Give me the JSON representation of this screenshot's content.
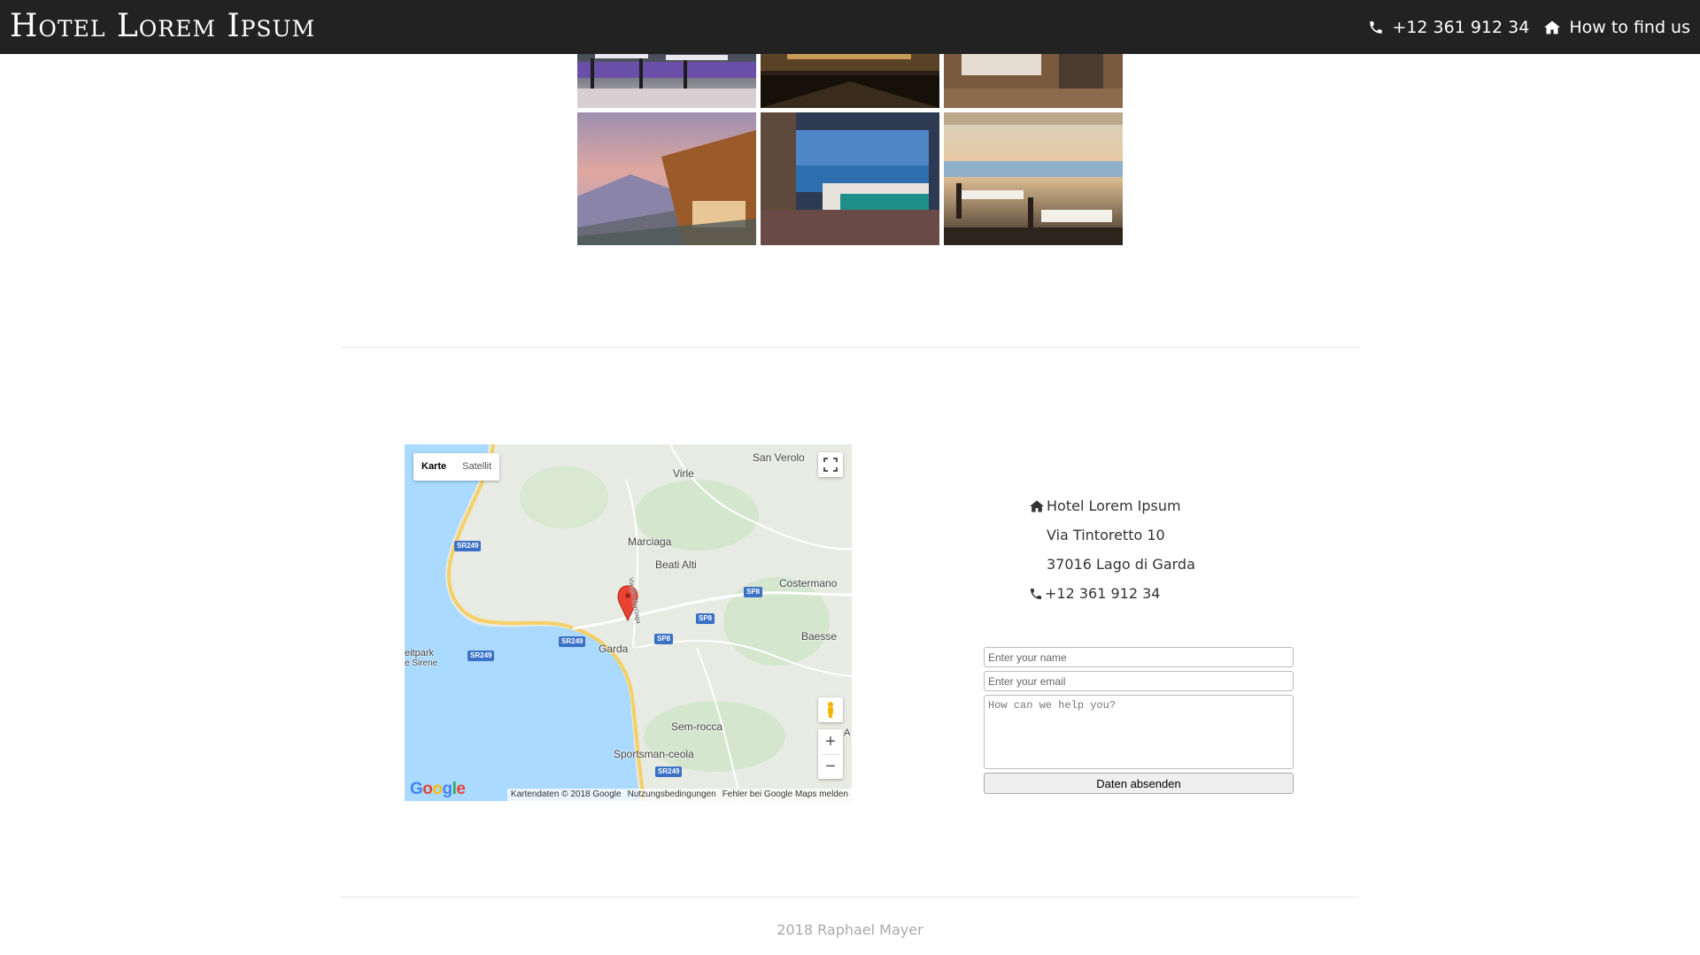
{
  "nav": {
    "brand": "Hotel Lorem Ipsum",
    "phone": "+12 361 912 34",
    "directions": "How to find us",
    "phone_icon": "phone-icon",
    "home_icon": "home-icon"
  },
  "gallery": {
    "images": [
      {
        "label": "restaurant-terrace"
      },
      {
        "label": "lobby-lounge"
      },
      {
        "label": "hotel-room"
      },
      {
        "label": "mountain-balcony"
      },
      {
        "label": "seaview-bedroom"
      },
      {
        "label": "seaside-dining"
      }
    ]
  },
  "map": {
    "map_type": [
      "Karte",
      "Satellit"
    ],
    "places": [
      "San Verolo",
      "Virle",
      "Marciaga",
      "Beati Alti",
      "Costermano",
      "Baesse",
      "Garda",
      "Sem-rocca",
      "Sportsman-ceola",
      "eitpark",
      "e Sirene",
      "A",
      "Via per Marciaga"
    ],
    "roads": [
      "SR249",
      "SR249",
      "SR249",
      "SR249",
      "SP8",
      "SP8",
      "SP8"
    ],
    "logo": "Google",
    "credits": [
      "Kartendaten © 2018 Google",
      "Nutzungsbedingungen",
      "Fehler bei Google Maps melden"
    ],
    "zoom_in": "+",
    "zoom_out": "−"
  },
  "contact": {
    "name": "Hotel Lorem Ipsum",
    "street": "Via Tintoretto 10",
    "city": "37016 Lago di Garda",
    "phone": "+12 361 912 34"
  },
  "form": {
    "name_placeholder": "Enter your name",
    "email_placeholder": "Enter your email",
    "message_placeholder": "How can we help you?",
    "submit": "Daten absenden"
  },
  "footer": {
    "text": "2018 Raphael Mayer"
  },
  "colors": {
    "nav_bg": "#222222",
    "water": "#aadaff",
    "pin": "#ea4335"
  }
}
